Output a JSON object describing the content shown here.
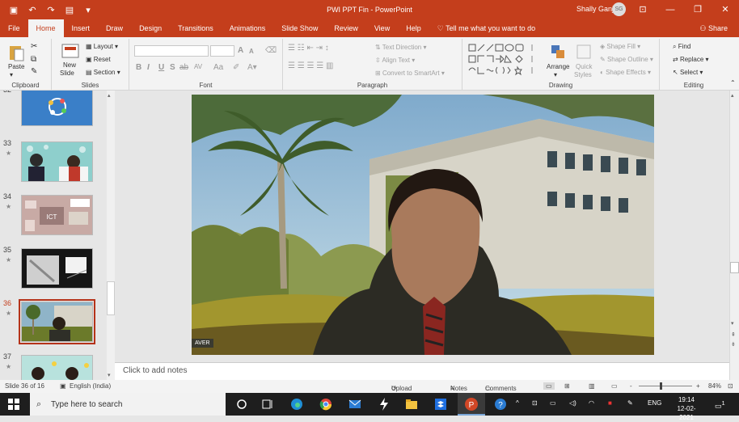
{
  "window": {
    "title": "PWI PPT Fin  -  PowerPoint",
    "user_name": "Shally Ganju",
    "user_initials": "SG"
  },
  "tabs": [
    {
      "label": "File"
    },
    {
      "label": "Home"
    },
    {
      "label": "Insert"
    },
    {
      "label": "Draw"
    },
    {
      "label": "Design"
    },
    {
      "label": "Transitions"
    },
    {
      "label": "Animations"
    },
    {
      "label": "Slide Show"
    },
    {
      "label": "Review"
    },
    {
      "label": "View"
    },
    {
      "label": "Help"
    }
  ],
  "active_tab": "Home",
  "tell_me": "Tell me what you want to do",
  "share": "Share",
  "ribbon": {
    "clipboard": {
      "label": "Clipboard",
      "paste": "Paste"
    },
    "slides": {
      "label": "Slides",
      "new_slide_1": "New",
      "new_slide_2": "Slide",
      "layout": "Layout",
      "reset": "Reset",
      "section": "Section"
    },
    "font": {
      "label": "Font",
      "bold": "B",
      "italic": "I",
      "underline": "U",
      "strike": "S",
      "abc": "ab",
      "spacing": "AV",
      "case": "Aa",
      "grow": "A",
      "shrink": "A"
    },
    "paragraph": {
      "label": "Paragraph",
      "text_direction": "Text Direction",
      "align_text": "Align Text",
      "smartart": "Convert to SmartArt"
    },
    "drawing": {
      "label": "Drawing",
      "arrange": "Arrange",
      "quick_styles_1": "Quick",
      "quick_styles_2": "Styles",
      "shape_fill": "Shape Fill",
      "shape_outline": "Shape Outline",
      "shape_effects": "Shape Effects"
    },
    "editing": {
      "label": "Editing",
      "find": "Find",
      "replace": "Replace",
      "select": "Select"
    }
  },
  "thumbnails": [
    {
      "num": "32",
      "star": "★"
    },
    {
      "num": "33",
      "star": "★"
    },
    {
      "num": "34",
      "star": "★"
    },
    {
      "num": "35",
      "star": "★"
    },
    {
      "num": "36",
      "star": "★"
    },
    {
      "num": "37",
      "star": "★"
    }
  ],
  "slide_badge": "AVER",
  "notes_placeholder": "Click to add notes",
  "status": {
    "slide_info": "Slide 36 of 16",
    "language": "English (India)",
    "upload": "Upload Failed",
    "notes": "Notes",
    "comments": "Comments",
    "zoom_minus": "-",
    "zoom_plus": "+",
    "zoom": "84%"
  },
  "taskbar": {
    "search_placeholder": "Type here to search",
    "lang": "ENG",
    "time": "19:14",
    "date": "12-02-2021",
    "notification_count": "1"
  },
  "colors": {
    "accent": "#c43e1c",
    "selected_thumb": "#b5331a"
  }
}
